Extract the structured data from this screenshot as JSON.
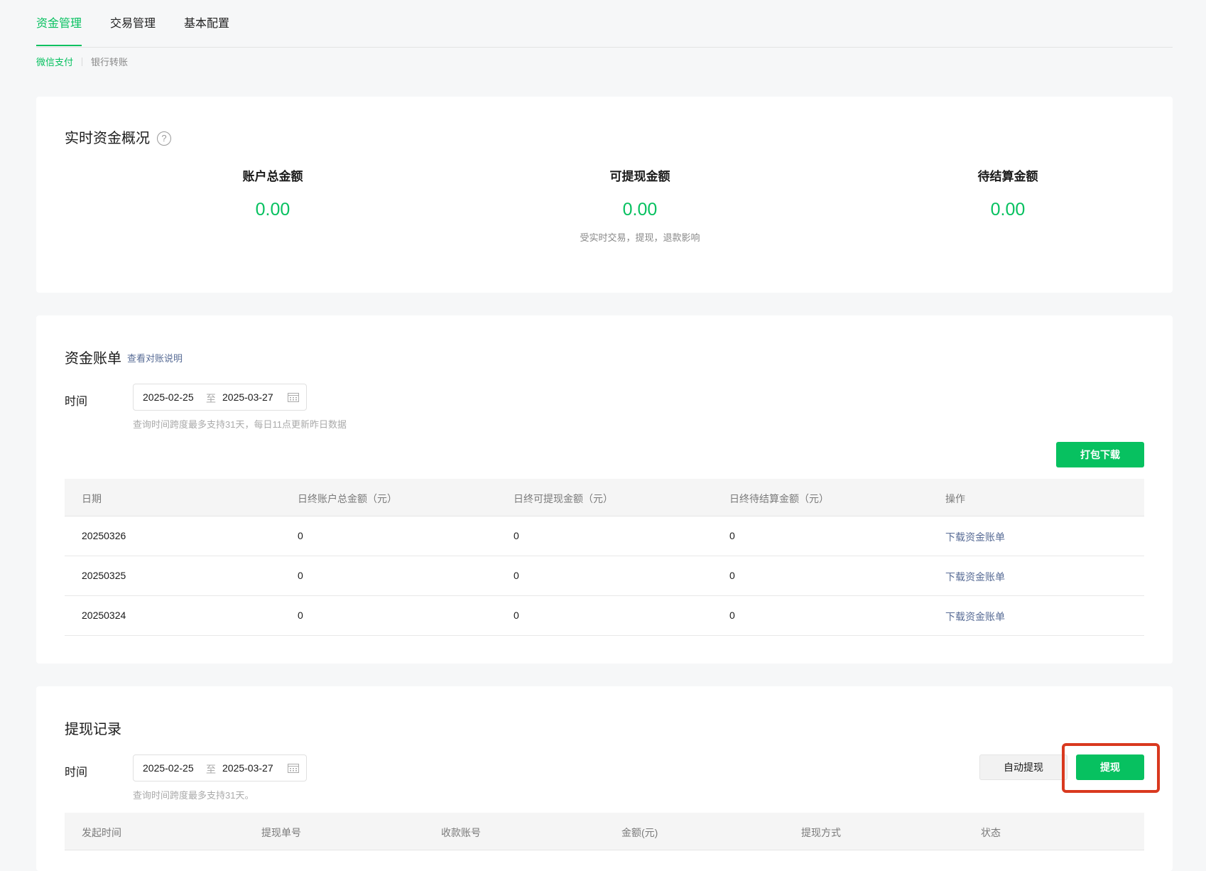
{
  "tabs": [
    "资金管理",
    "交易管理",
    "基本配置"
  ],
  "subtabs": [
    "微信支付",
    "银行转账"
  ],
  "overview": {
    "title": "实时资金概况",
    "stats": [
      {
        "label": "账户总金额",
        "value": "0.00"
      },
      {
        "label": "可提现金额",
        "value": "0.00",
        "note": "受实时交易，提现，退款影响"
      },
      {
        "label": "待结算金额",
        "value": "0.00"
      }
    ]
  },
  "bill": {
    "title": "资金账单",
    "link": "查看对账说明",
    "time_label": "时间",
    "date_start": "2025-02-25",
    "date_to": "至",
    "date_end": "2025-03-27",
    "hint": "查询时间跨度最多支持31天，每日11点更新昨日数据",
    "download_button": "打包下载",
    "columns": [
      "日期",
      "日终账户总金额（元）",
      "日终可提现金额（元）",
      "日终待结算金额（元）",
      "操作"
    ],
    "rows": [
      [
        "20250326",
        "0",
        "0",
        "0",
        "下载资金账单"
      ],
      [
        "20250325",
        "0",
        "0",
        "0",
        "下载资金账单"
      ],
      [
        "20250324",
        "0",
        "0",
        "0",
        "下载资金账单"
      ]
    ]
  },
  "withdraw": {
    "title": "提现记录",
    "time_label": "时间",
    "date_start": "2025-02-25",
    "date_to": "至",
    "date_end": "2025-03-27",
    "hint": "查询时间跨度最多支持31天。",
    "auto_button": "自动提现",
    "withdraw_button": "提现",
    "columns": [
      "发起时间",
      "提现单号",
      "收款账号",
      "金额(元)",
      "提现方式",
      "状态"
    ]
  }
}
